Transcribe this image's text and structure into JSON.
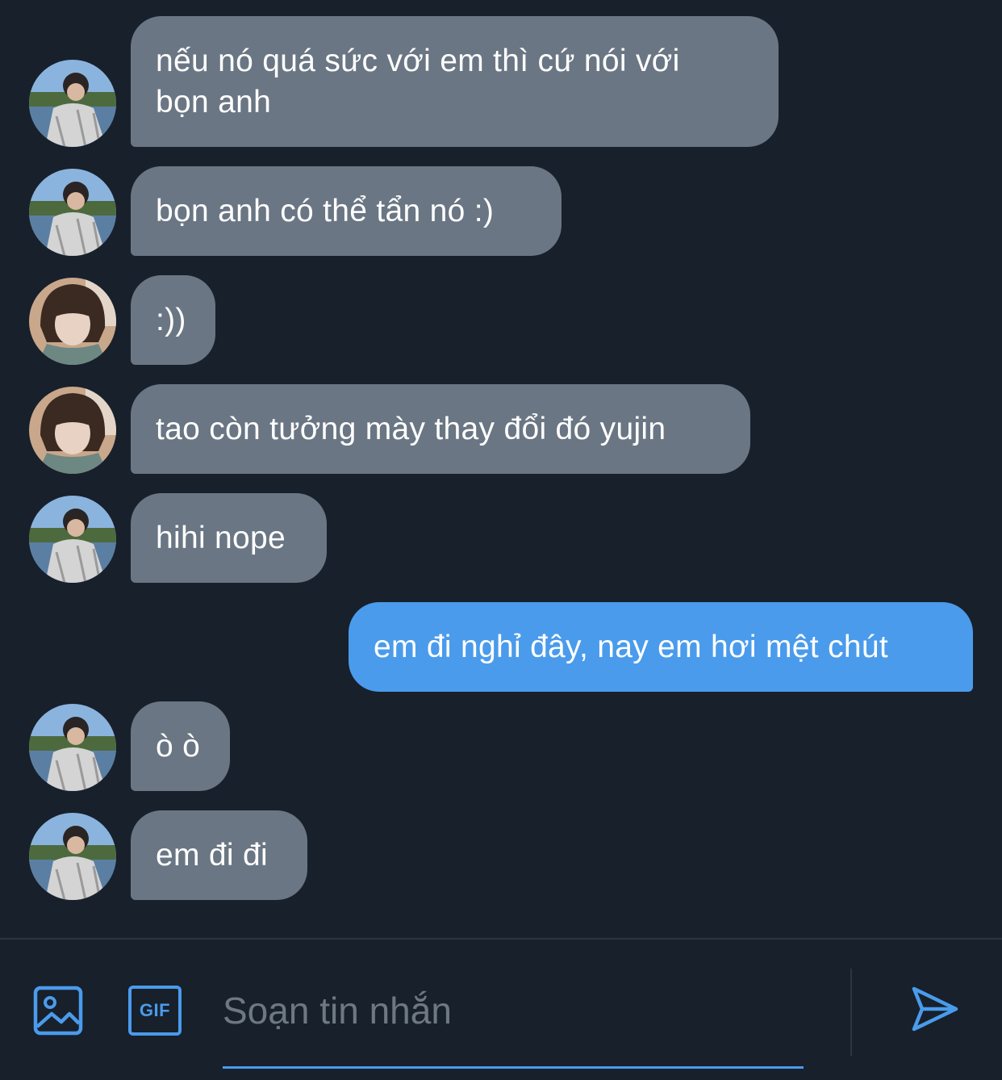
{
  "conversation": {
    "messages": [
      {
        "sender": "other",
        "avatar": "avatar-lake",
        "text": "nếu nó quá sức với em thì cứ nói với\nbọn anh"
      },
      {
        "sender": "other",
        "avatar": "avatar-lake",
        "text": "bọn anh có thể tẩn nó :)"
      },
      {
        "sender": "other",
        "avatar": "avatar-brown-hair",
        "text": ":))"
      },
      {
        "sender": "other",
        "avatar": "avatar-brown-hair",
        "text": "tao còn tưởng mày thay đổi đó yujin"
      },
      {
        "sender": "other",
        "avatar": "avatar-lake",
        "text": "hihi nope"
      },
      {
        "sender": "me",
        "text": "em đi nghỉ đây, nay em hơi mệt chút"
      },
      {
        "sender": "other",
        "avatar": "avatar-lake",
        "text": "ò ò"
      },
      {
        "sender": "other",
        "avatar": "avatar-lake",
        "text": "em đi đi"
      }
    ]
  },
  "composer": {
    "placeholder": "Soạn tin nhắn",
    "value": "",
    "gif_label": "GIF",
    "image_icon": "image-icon",
    "send_icon": "send-icon"
  },
  "colors": {
    "background": "#18202b",
    "incoming_bubble": "#6a7683",
    "outgoing_bubble": "#4a9beb",
    "accent": "#4a9beb"
  }
}
